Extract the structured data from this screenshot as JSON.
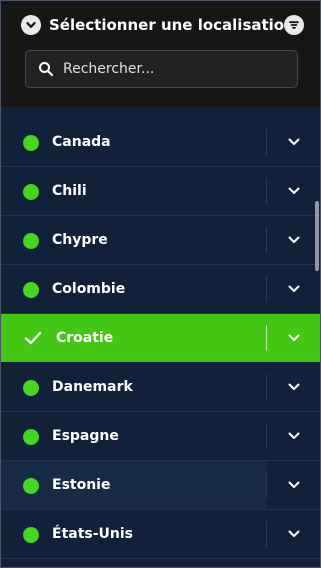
{
  "header": {
    "title": "Sélectionner une localisation",
    "back_icon": "chevron-down-circle-icon",
    "filter_icon": "filter-icon"
  },
  "search": {
    "placeholder": "Rechercher..."
  },
  "list": {
    "items": [
      {
        "label": "Canada",
        "selected": false
      },
      {
        "label": "Chili",
        "selected": false
      },
      {
        "label": "Chypre",
        "selected": false
      },
      {
        "label": "Colombie",
        "selected": false
      },
      {
        "label": "Croatie",
        "selected": true
      },
      {
        "label": "Danemark",
        "selected": false
      },
      {
        "label": "Espagne",
        "selected": false
      },
      {
        "label": "Estonie",
        "selected": false
      },
      {
        "label": "États-Unis",
        "selected": false
      }
    ]
  },
  "colors": {
    "status_dot": "#45d61f",
    "selected_row": "#44c615",
    "list_background": "#12213a",
    "header_background": "#161616"
  }
}
